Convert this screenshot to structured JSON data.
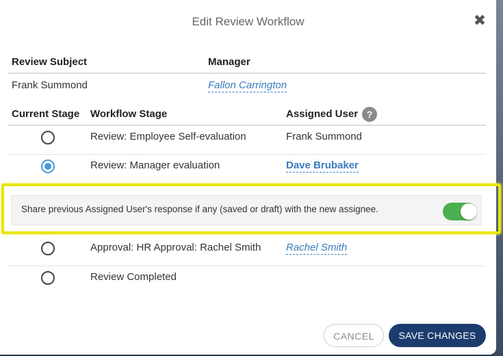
{
  "modal": {
    "title": "Edit Review Workflow",
    "close_icon": "✖"
  },
  "subject_table": {
    "headers": {
      "review_subject": "Review Subject",
      "manager": "Manager"
    },
    "review_subject": "Frank Summond",
    "manager": "Fallon Carrington"
  },
  "workflow_table": {
    "headers": {
      "current_stage": "Current Stage",
      "workflow_stage": "Workflow Stage",
      "assigned_user": "Assigned User"
    },
    "help_icon": "?",
    "rows": [
      {
        "stage": "Review: Employee Self-evaluation",
        "assigned_user": "Frank Summond",
        "selected": false,
        "user_style": "plain"
      },
      {
        "stage": "Review: Manager evaluation",
        "assigned_user": "Dave Brubaker",
        "selected": true,
        "user_style": "bold-link"
      },
      {
        "stage": "Approval: HR Approval: Rachel Smith",
        "assigned_user": "Rachel Smith",
        "selected": false,
        "user_style": "italic-link"
      },
      {
        "stage": "Review Completed",
        "assigned_user": "",
        "selected": false,
        "user_style": "plain"
      }
    ]
  },
  "share_option": {
    "label": "Share previous Assigned User's response if any (saved or draft) with the new assignee.",
    "enabled": true
  },
  "footer": {
    "cancel_label": "CANCEL",
    "save_label": "SAVE CHANGES"
  },
  "colors": {
    "accent": "#3a7bbd",
    "radio_selected": "#4a9ad8",
    "toggle_on": "#4caf50",
    "primary_button": "#1d3c6e",
    "highlight": "#e8e600"
  }
}
